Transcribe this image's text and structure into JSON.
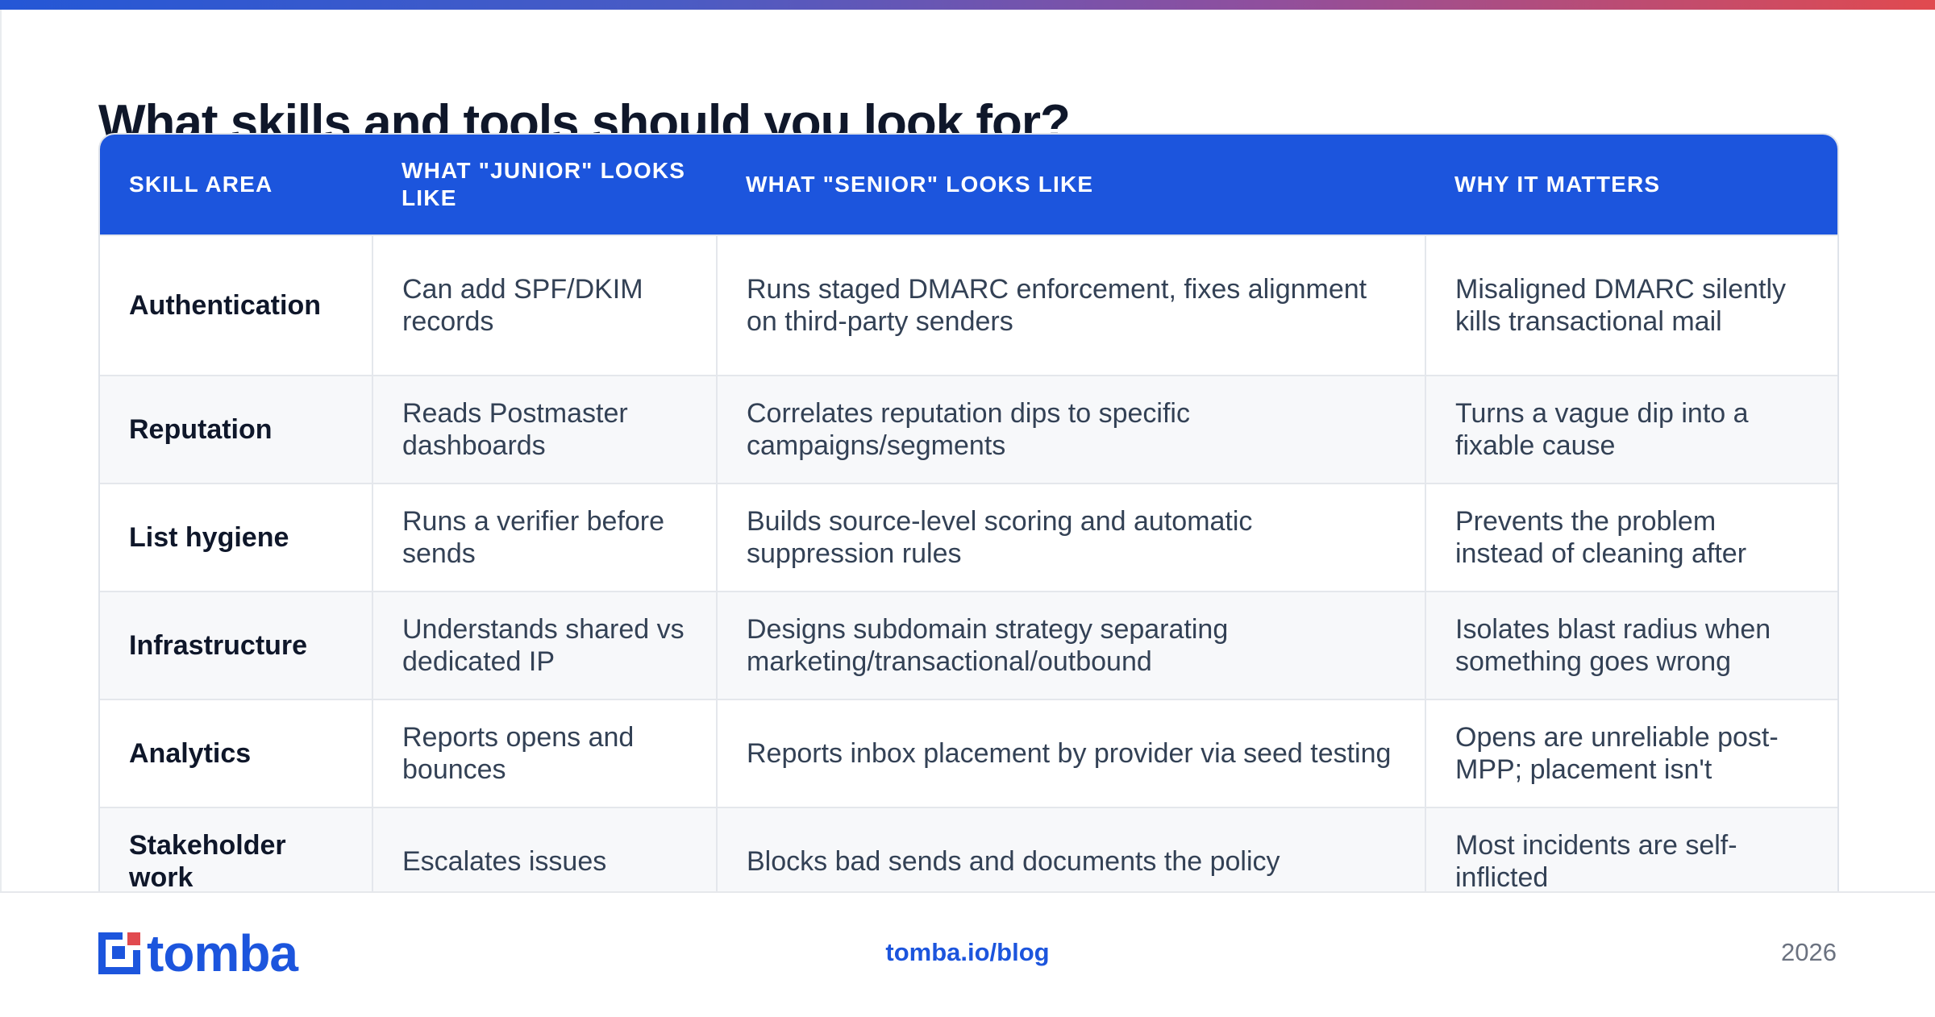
{
  "title": "What skills and tools should you look for?",
  "table": {
    "headers": [
      "SKILL AREA",
      "WHAT \"JUNIOR\" LOOKS LIKE",
      "WHAT \"SENIOR\" LOOKS LIKE",
      "WHY IT MATTERS"
    ],
    "rows": [
      {
        "skill": "Authentication",
        "junior": "Can add SPF/DKIM records",
        "senior": "Runs staged DMARC enforcement, fixes alignment on third-party senders",
        "why": "Misaligned DMARC silently kills transactional mail"
      },
      {
        "skill": "Reputation",
        "junior": "Reads Postmaster dashboards",
        "senior": "Correlates reputation dips to specific campaigns/segments",
        "why": "Turns a vague dip into a fixable cause"
      },
      {
        "skill": "List hygiene",
        "junior": "Runs a verifier before sends",
        "senior": "Builds source-level scoring and automatic suppression rules",
        "why": "Prevents the problem instead of cleaning after"
      },
      {
        "skill": "Infrastructure",
        "junior": "Understands shared vs dedicated IP",
        "senior": "Designs subdomain strategy separating marketing/transactional/outbound",
        "why": "Isolates blast radius when something goes wrong"
      },
      {
        "skill": "Analytics",
        "junior": "Reports opens and bounces",
        "senior": "Reports inbox placement by provider via seed testing",
        "why": "Opens are unreliable post-MPP; placement isn't"
      },
      {
        "skill": "Stakeholder work",
        "junior": "Escalates issues",
        "senior": "Blocks bad sends and documents the policy",
        "why": "Most incidents are self-inflicted"
      }
    ]
  },
  "footer": {
    "logo_text": "tomba",
    "link": "tomba.io/blog",
    "year": "2026"
  },
  "colors": {
    "brand_blue": "#1c55dd",
    "gradient_start": "#2457d6",
    "gradient_end": "#e14a4f"
  }
}
